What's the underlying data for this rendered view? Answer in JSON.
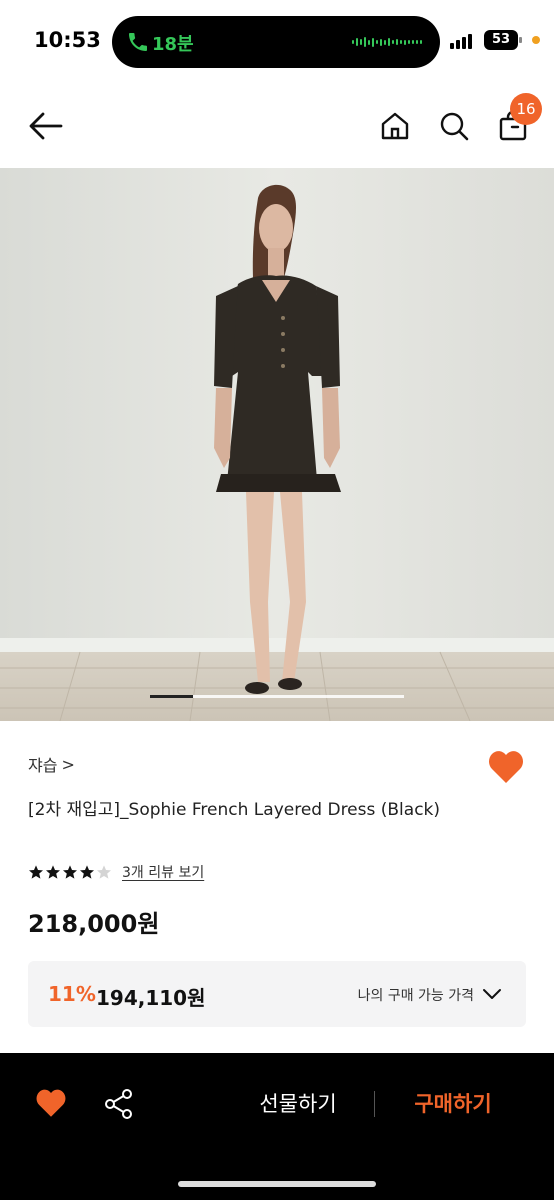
{
  "status_bar": {
    "time": "10:53",
    "call_duration": "18분",
    "battery": "53"
  },
  "header": {
    "cart_count": "16",
    "icons": [
      "back-arrow-icon",
      "home-icon",
      "search-icon",
      "shopping-bag-icon"
    ]
  },
  "carousel": {
    "current_page_fraction": 0.17
  },
  "product": {
    "brand": "쟈습",
    "brand_chevron": ">",
    "title": "[2차 재입고]_Sophie French Layered Dress (Black)",
    "rating": 4,
    "rating_max": 5,
    "review_link": "3개 리뷰 보기",
    "price": "218,000원",
    "my_price": {
      "discount": "11%",
      "price": "194,110원",
      "label": "나의 구매 가능 가격"
    }
  },
  "bottom_bar": {
    "gift_label": "선물하기",
    "buy_label": "구매하기"
  },
  "colors": {
    "accent": "#f0642a",
    "call_green": "#35c759",
    "bottom_bar_bg": "#000000",
    "my_price_bg": "#f4f4f5"
  }
}
